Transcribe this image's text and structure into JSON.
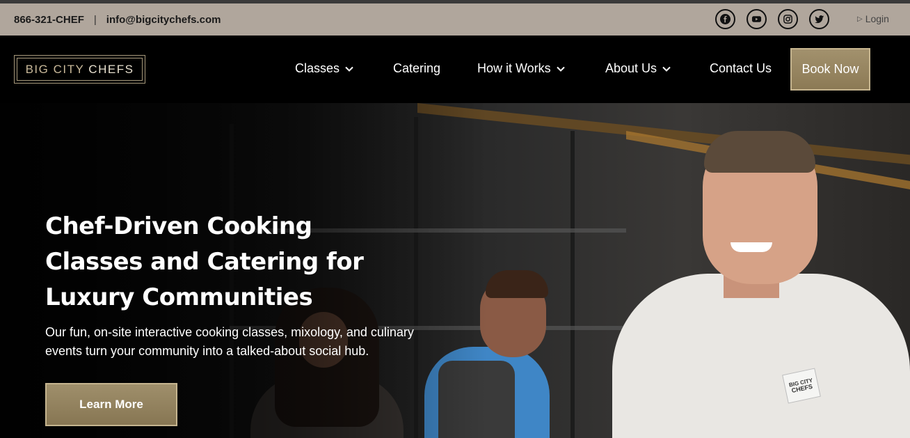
{
  "topbar": {
    "phone": "866-321-CHEF",
    "separator": "|",
    "email": "info@bigcitychefs.com",
    "socials": [
      "facebook-icon",
      "youtube-icon",
      "instagram-icon",
      "twitter-icon"
    ],
    "login_label": "Login"
  },
  "logo": {
    "part1": "BIG CITY",
    "part2": "CHEFS"
  },
  "nav": {
    "items": [
      {
        "label": "Classes",
        "dropdown": true
      },
      {
        "label": "Catering",
        "dropdown": false
      },
      {
        "label": "How it Works",
        "dropdown": true
      },
      {
        "label": "About Us",
        "dropdown": true
      },
      {
        "label": "Contact Us",
        "dropdown": false
      }
    ],
    "book_label": "Book Now"
  },
  "hero": {
    "title": "Chef-Driven Cooking Classes and Catering for Luxury Communities",
    "subtitle": "Our fun, on-site interactive cooking classes, mixology, and culinary events turn your community into a talked-about social hub.",
    "cta_label": "Learn More",
    "badge_line1": "BIG CITY",
    "badge_line2": "CHEFS"
  },
  "colors": {
    "topbar_bg": "#b0a69c",
    "accent_gold": "#9a8964",
    "nav_bg": "#000000",
    "text_white": "#ffffff"
  }
}
